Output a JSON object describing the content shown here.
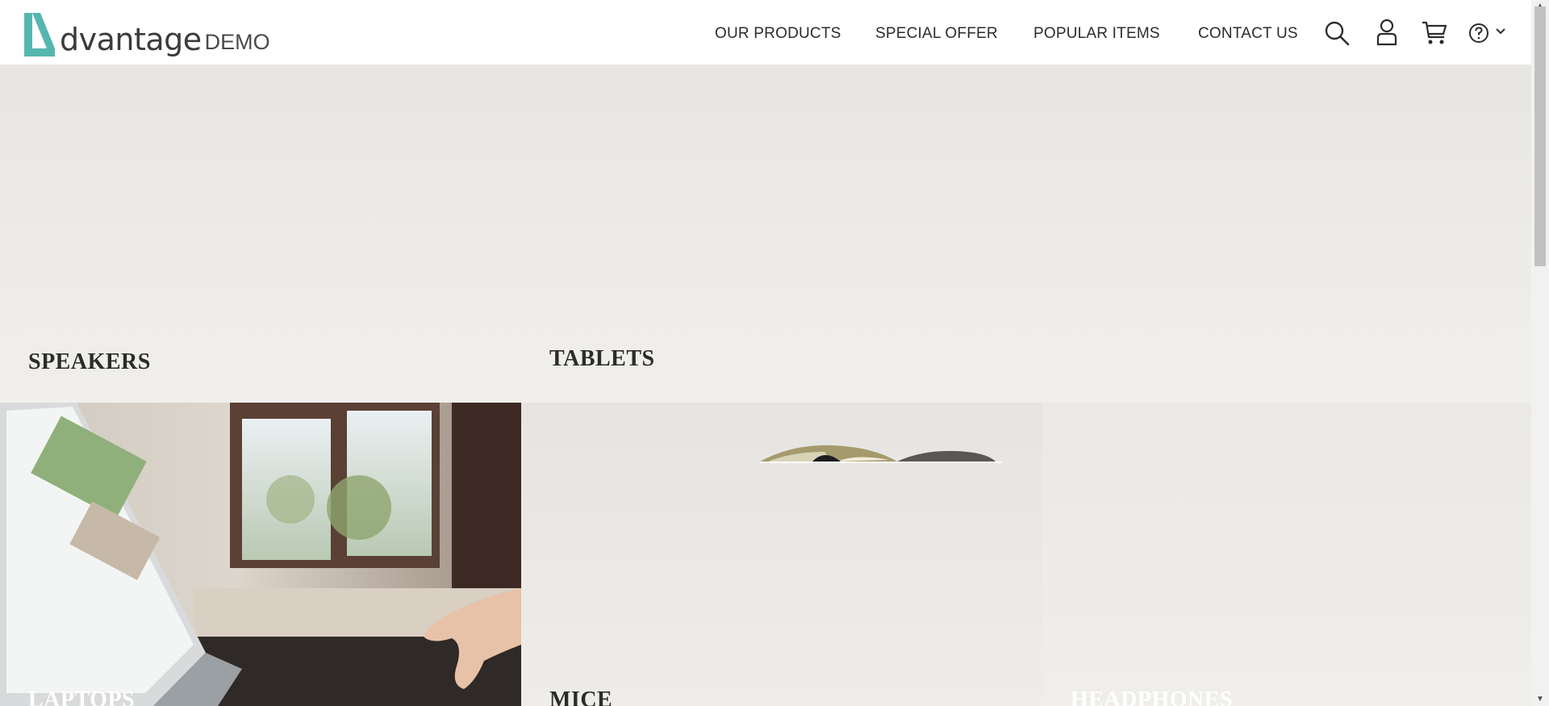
{
  "brand": {
    "name": "dvantage",
    "suffix": "DEMO",
    "accent": "#55b6b0"
  },
  "nav": {
    "items": [
      {
        "label": "OUR PRODUCTS"
      },
      {
        "label": "SPECIAL OFFER"
      },
      {
        "label": "POPULAR ITEMS"
      },
      {
        "label": "CONTACT US"
      }
    ],
    "icons": [
      "search-icon",
      "user-icon",
      "cart-icon",
      "help-icon",
      "chevron-down-icon"
    ]
  },
  "categories": [
    {
      "label": "SPEAKERS"
    },
    {
      "label": "TABLETS"
    },
    {
      "label": "LAPTOPS"
    },
    {
      "label": "MICE"
    },
    {
      "label": "HEADPHONES"
    }
  ],
  "colors": {
    "tile_bg": "#ebe9e5",
    "label_dark": "#2b2b2b",
    "label_light": "#ffffff"
  }
}
